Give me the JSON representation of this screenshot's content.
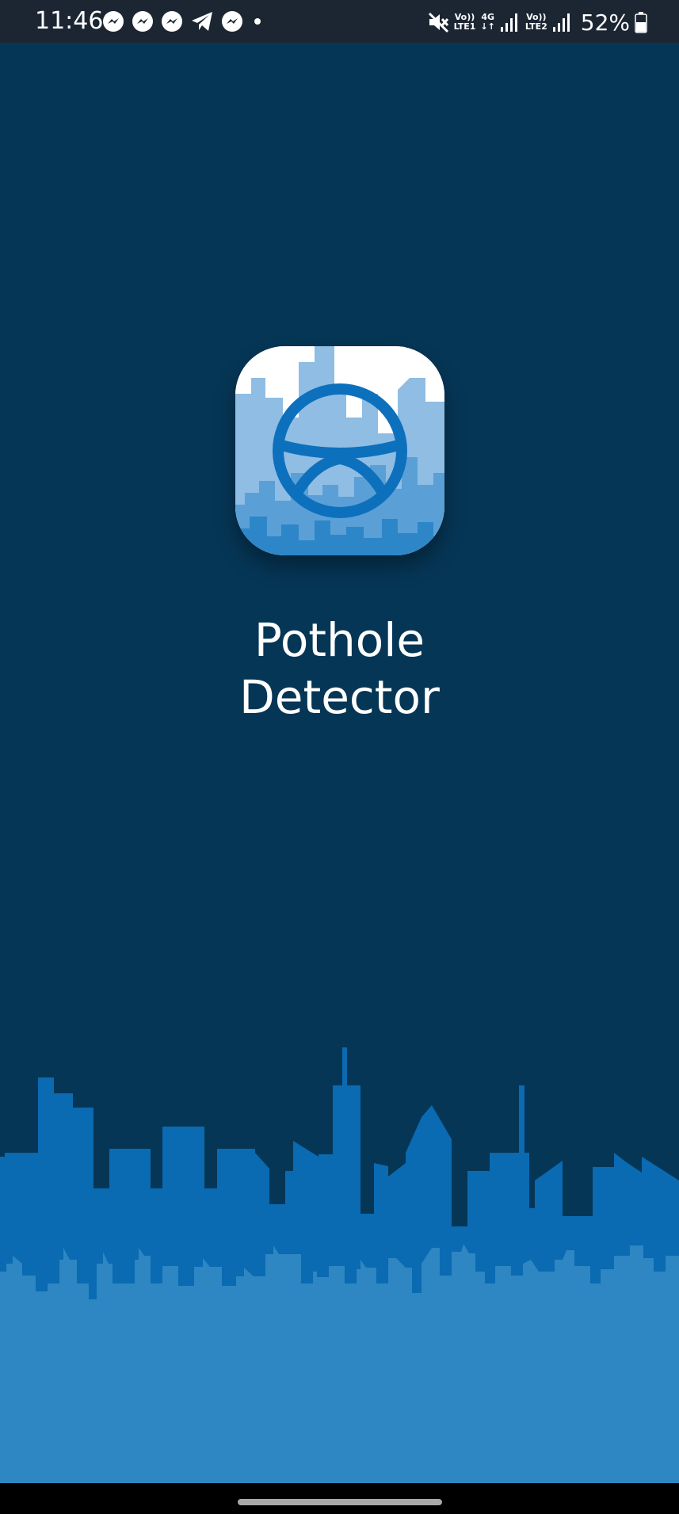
{
  "status_bar": {
    "time": "11:46",
    "notification_icons": [
      "messenger-icon",
      "messenger-icon",
      "messenger-icon",
      "telegram-icon",
      "messenger-icon",
      "more-dot-icon"
    ],
    "sim1_label_top": "Vo))",
    "sim1_label_bottom": "LTE1",
    "network_label_top": "4G",
    "network_label_bottom": "↓↑",
    "sim2_label_top": "Vo))",
    "sim2_label_bottom": "LTE2",
    "battery_percent": "52%"
  },
  "splash": {
    "title_line1": "Pothole",
    "title_line2": "Detector",
    "icon": "steering-wheel-icon"
  },
  "colors": {
    "background": "#063656",
    "skyline_back": "#0a6ab2",
    "skyline_front": "#2e86c2",
    "icon_wheel": "#0d70bd"
  }
}
